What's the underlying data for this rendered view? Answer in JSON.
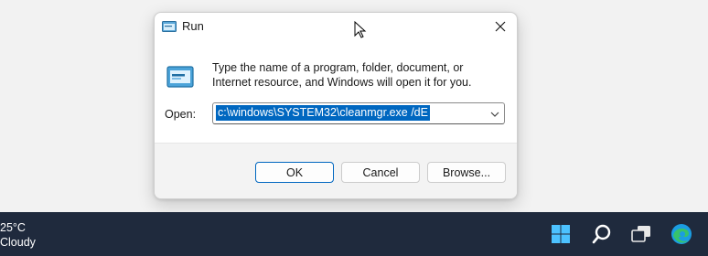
{
  "dialog": {
    "title": "Run",
    "description": "Type the name of a program, folder, document, or Internet resource, and Windows will open it for you.",
    "open_label": "Open:",
    "open_value": "c:\\windows\\SYSTEM32\\cleanmgr.exe /dE",
    "buttons": {
      "ok": "OK",
      "cancel": "Cancel",
      "browse": "Browse..."
    }
  },
  "taskbar": {
    "weather_temp": "25°C",
    "weather_condition": "Cloudy",
    "icons": [
      "start-icon",
      "search-icon",
      "task-view-icon",
      "edge-icon"
    ]
  },
  "colors": {
    "accent": "#0067c0",
    "taskbar": "#1f2a3d",
    "footer": "#f3f3f3"
  }
}
